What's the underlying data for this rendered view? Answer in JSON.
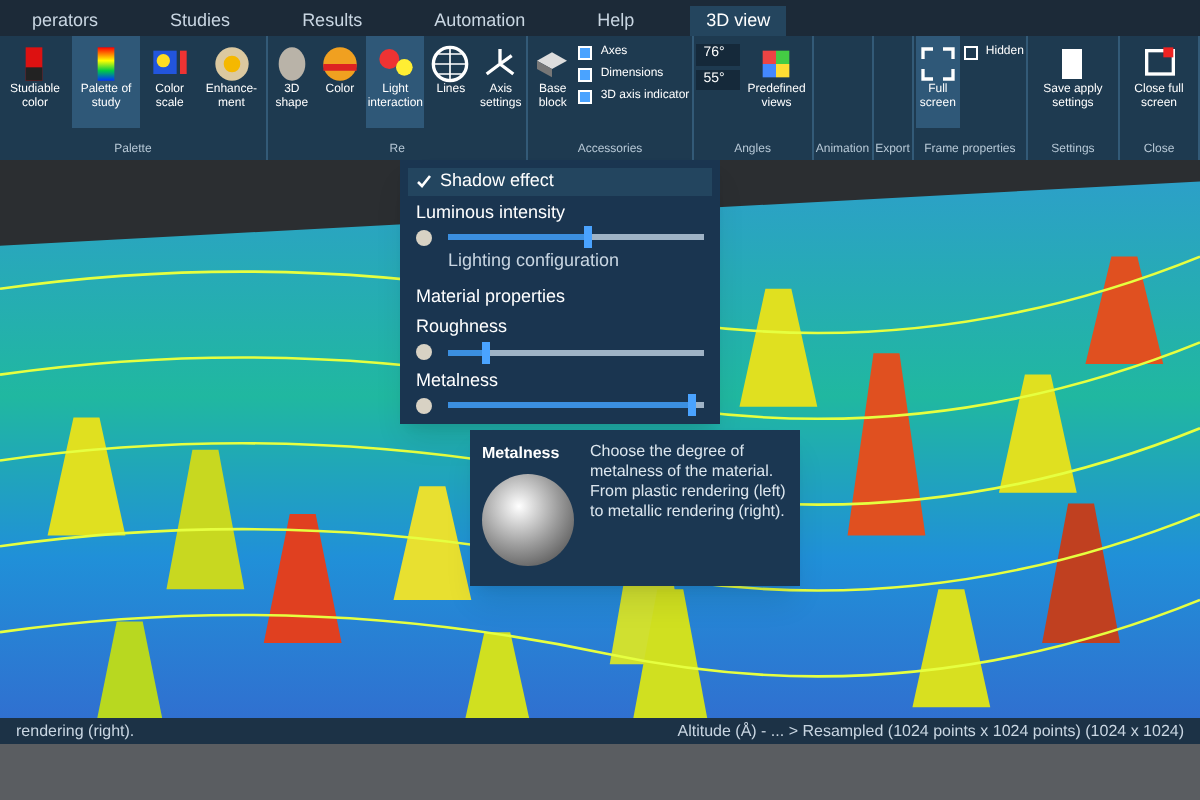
{
  "tabs": [
    {
      "label": "perators",
      "selected": false
    },
    {
      "label": "Studies",
      "selected": false
    },
    {
      "label": "Results",
      "selected": false
    },
    {
      "label": "Automation",
      "selected": false
    },
    {
      "label": "Help",
      "selected": false
    },
    {
      "label": "3D view",
      "selected": true
    }
  ],
  "ribbon_groups": [
    {
      "label": "Palette",
      "buttons": [
        {
          "label": "Studiable color",
          "kind": "swatch",
          "selected": false
        },
        {
          "label": "Palette of study",
          "kind": "palette",
          "selected": true
        },
        {
          "label": "Color scale",
          "kind": "scale",
          "selected": false
        },
        {
          "label": "Enhance-ment",
          "kind": "sun",
          "selected": false
        }
      ]
    },
    {
      "label": "Re",
      "buttons": [
        {
          "label": "3D shape",
          "kind": "sphere",
          "selected": false
        },
        {
          "label": "Color",
          "kind": "ball",
          "selected": false
        },
        {
          "label": "Light interaction",
          "kind": "light",
          "selected": true
        },
        {
          "label": "Lines",
          "kind": "grid",
          "selected": false
        },
        {
          "label": "Axis settings",
          "kind": "axis",
          "selected": false
        }
      ]
    },
    {
      "label": "Accessories",
      "buttons": [
        {
          "label": "Base block",
          "kind": "block",
          "selected": false
        }
      ],
      "checks": [
        {
          "label": "Axes",
          "checked": true
        },
        {
          "label": "Dimensions",
          "checked": true
        },
        {
          "label": "3D axis indicator",
          "checked": true
        }
      ]
    },
    {
      "label": "Angles",
      "fields": [
        "76°",
        "55°"
      ],
      "buttons": [
        {
          "label": "Predefined views",
          "kind": "cube",
          "selected": false
        }
      ]
    },
    {
      "label": "Animation"
    },
    {
      "label": "Export"
    },
    {
      "label": "Frame properties",
      "buttons": [
        {
          "label": "Full screen",
          "kind": "full",
          "selected": true
        }
      ],
      "checks": [
        {
          "label": "Hidden",
          "checked": false
        }
      ]
    },
    {
      "label": "Settings",
      "buttons": [
        {
          "label": "Save apply settings",
          "kind": "save",
          "selected": false
        }
      ]
    },
    {
      "label": "Close",
      "buttons": [
        {
          "label": "Close full screen",
          "kind": "close",
          "selected": false
        }
      ]
    }
  ],
  "light_menu": [
    {
      "kind": "check",
      "label": "Shadow effect",
      "checked": true
    },
    {
      "kind": "slider",
      "label": "Luminous intensity",
      "level": 0.55
    },
    {
      "kind": "link",
      "label": "Lighting configuration"
    },
    {
      "kind": "header",
      "label": "Material properties"
    },
    {
      "kind": "slider",
      "label": "Roughness",
      "level": 0.15
    },
    {
      "kind": "slider",
      "label": "Metalness",
      "level": 0.95
    }
  ],
  "tooltip": {
    "title": "Metalness",
    "text": "Choose the degree of metalness of the material. From plastic rendering (left) to metallic rendering (right)."
  },
  "status_bar": {
    "path": "Altitude (Å) - ... > Resampled (1024 points x 1024 points) (1024 x 1024)",
    "hint": "rendering (right)."
  }
}
